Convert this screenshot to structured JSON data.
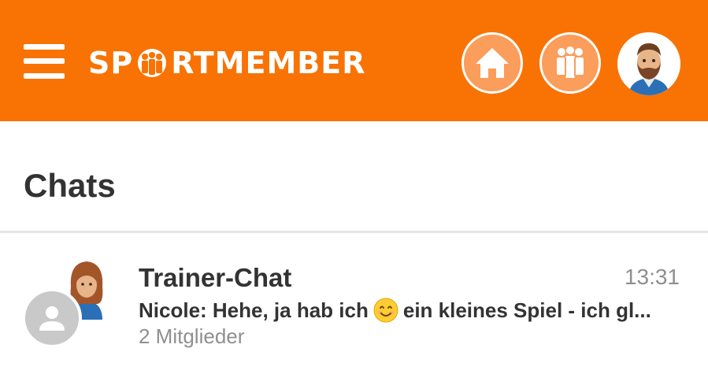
{
  "header": {
    "brand_before": "SP",
    "brand_after": "RTMEMBER",
    "brand_color": "#f87304",
    "icons": [
      "menu-icon",
      "home-icon",
      "members-icon",
      "user-avatar"
    ]
  },
  "page": {
    "title": "Chats"
  },
  "chats": [
    {
      "name": "Trainer-Chat",
      "time": "13:31",
      "preview_before": "Nicole: Hehe, ja hab ich",
      "preview_emoji": "smiling-face-emoji",
      "preview_after": "ein kleines Spiel - ich gl...",
      "members": "2 Mitglieder"
    }
  ]
}
